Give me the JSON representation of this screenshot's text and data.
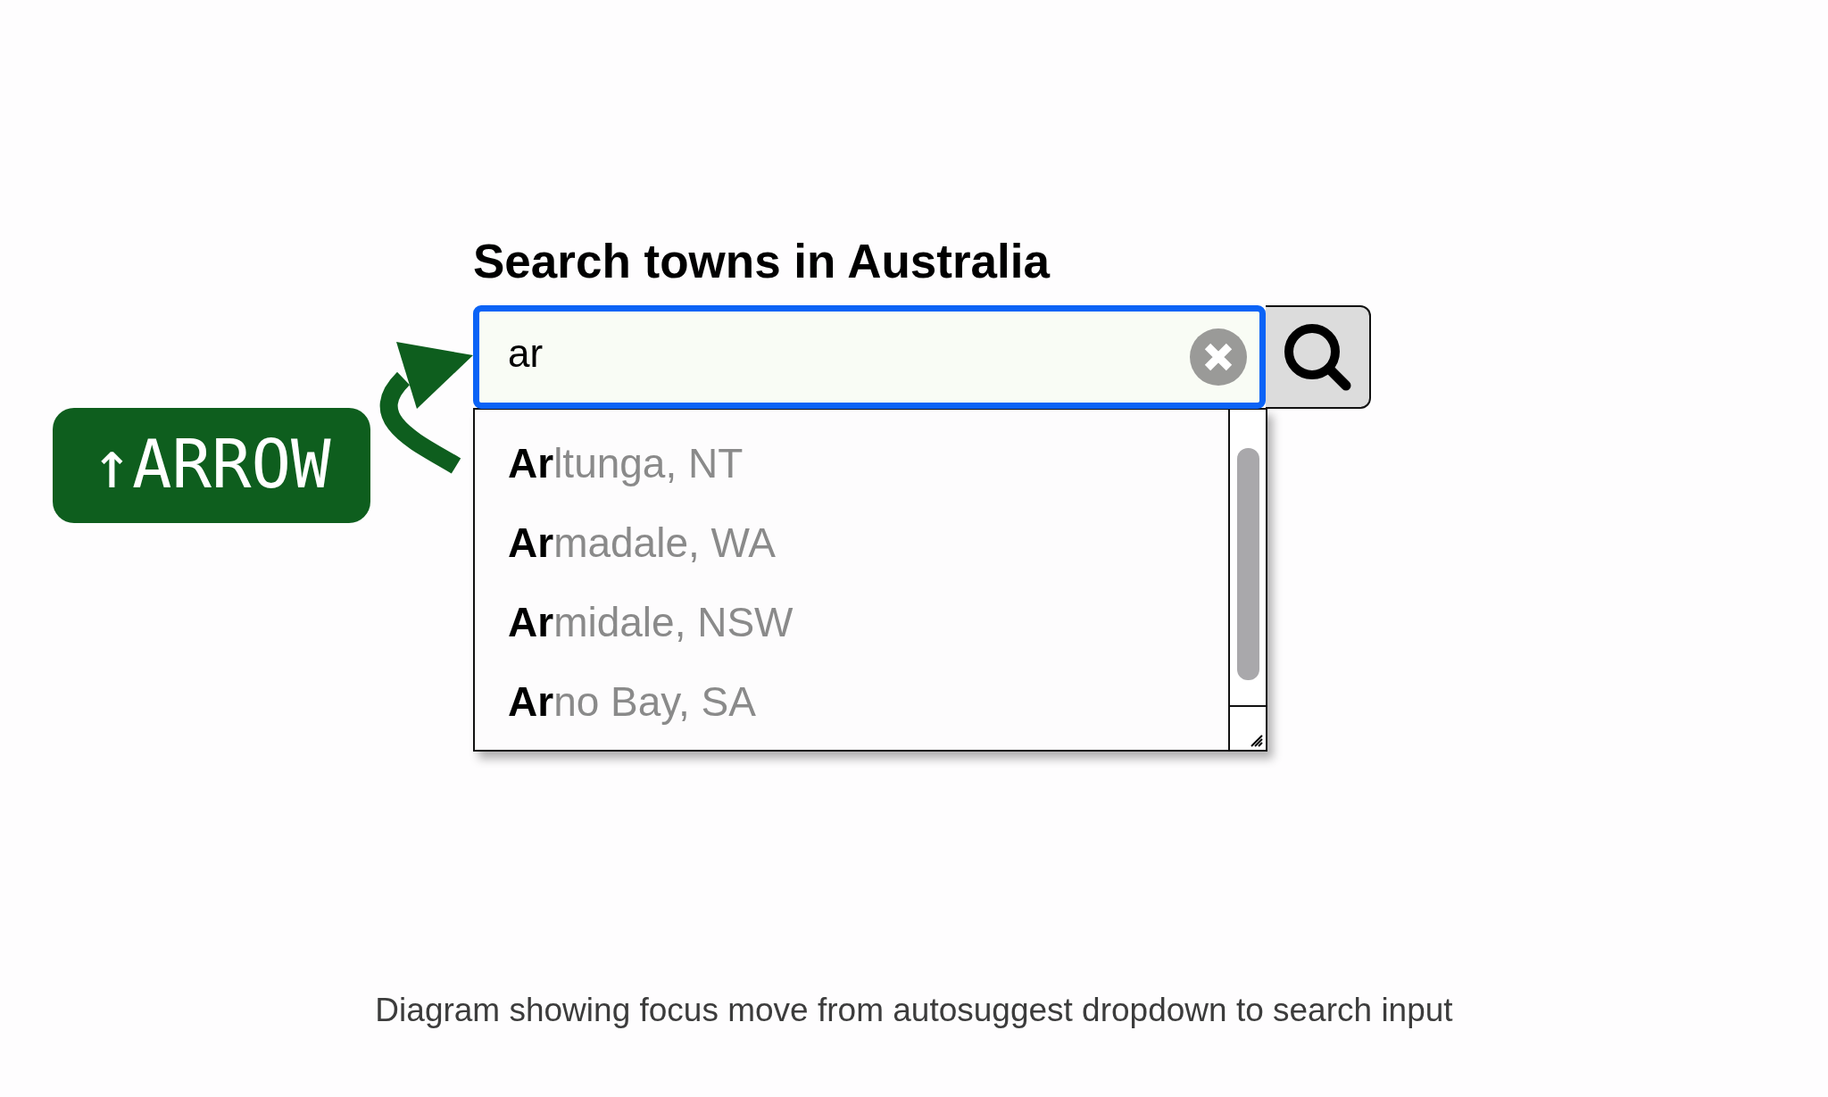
{
  "hint_key": {
    "label": "↑ARROW"
  },
  "search": {
    "title": "Search towns in Australia",
    "value": "ar",
    "focused": true
  },
  "suggestions": [
    {
      "label": "**Ar**ltunga, NT",
      "selected": false
    },
    {
      "label": "**Ar**madale, WA",
      "selected": false
    },
    {
      "label": "**Ar**midale, NSW",
      "selected": false
    },
    {
      "label": "**Ar**no Bay, SA",
      "selected": false
    }
  ],
  "caption": "Diagram showing focus move from autosuggest dropdown to search input"
}
